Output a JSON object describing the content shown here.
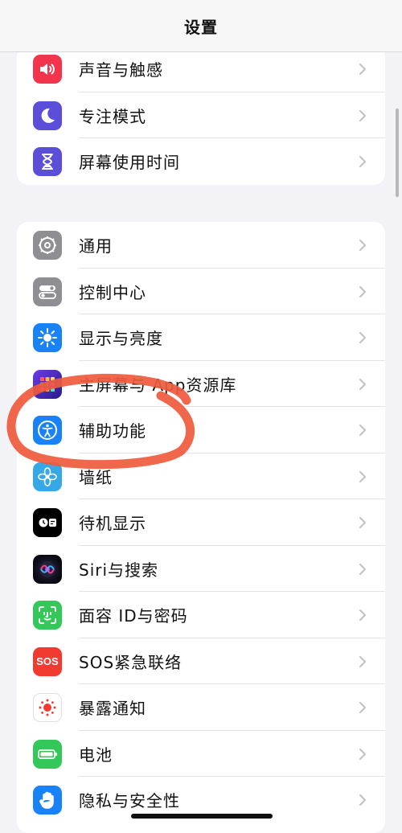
{
  "nav": {
    "title": "设置"
  },
  "group1": [
    {
      "label": "声音与触感",
      "icon": "speaker-icon",
      "color": "#f2344d"
    },
    {
      "label": "专注模式",
      "icon": "moon-icon",
      "color": "#5b4fd9"
    },
    {
      "label": "屏幕使用时间",
      "icon": "hourglass-icon",
      "color": "#5b4fd9"
    }
  ],
  "group2": [
    {
      "label": "通用",
      "icon": "gear-icon",
      "color": "#8e8e93"
    },
    {
      "label": "控制中心",
      "icon": "toggles-icon",
      "color": "#8e8e93"
    },
    {
      "label": "显示与亮度",
      "icon": "sun-icon",
      "color": "#1a82f7"
    },
    {
      "label": "主屏幕与 App资源库",
      "icon": "home-grid-icon",
      "color": "#5b2ee0"
    },
    {
      "label": "辅助功能",
      "icon": "accessibility-icon",
      "color": "#1a82f7"
    },
    {
      "label": "墙纸",
      "icon": "flower-icon",
      "color": "#37a8e6"
    },
    {
      "label": "待机显示",
      "icon": "standby-icon",
      "color": "#000000"
    },
    {
      "label": "Siri与搜索",
      "icon": "siri-icon",
      "color": "#1b1b2e"
    },
    {
      "label": "面容 ID与密码",
      "icon": "faceid-icon",
      "color": "#34c759"
    },
    {
      "label": "SOS紧急联络",
      "icon": "sos-icon",
      "color": "#f23b30"
    },
    {
      "label": "暴露通知",
      "icon": "exposure-icon",
      "color": "#ffffff"
    },
    {
      "label": "电池",
      "icon": "battery-icon",
      "color": "#34c759"
    },
    {
      "label": "隐私与安全性",
      "icon": "hand-icon",
      "color": "#1a82f7"
    }
  ],
  "sos_icon_text": "SOS",
  "annotation_color": "#f05a3c"
}
